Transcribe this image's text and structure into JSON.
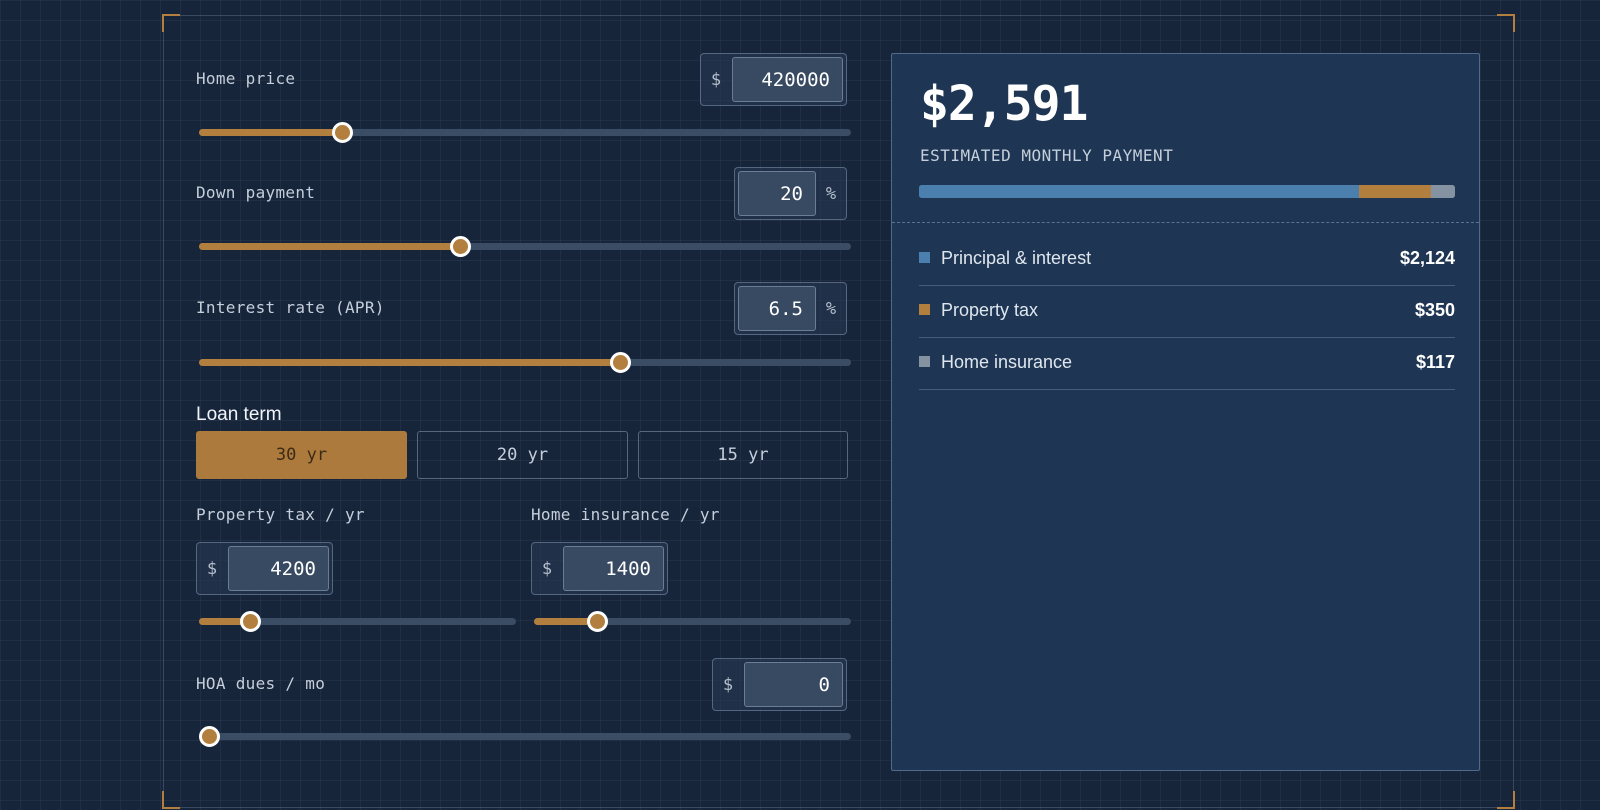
{
  "colors": {
    "accent": "#b27f3e",
    "principal": "#4a7fae",
    "tax": "#b27f3e",
    "insurance": "#8592a2",
    "panel": "#1e3653"
  },
  "home_price": {
    "label": "Home price",
    "prefix": "$",
    "value": "420000",
    "slider_level": 0.22
  },
  "down_payment": {
    "label": "Down payment",
    "value": "20",
    "suffix": "%",
    "slider_level": 0.4
  },
  "interest_rate": {
    "label": "Interest rate (APR)",
    "value": "6.5",
    "suffix": "%",
    "slider_level": 0.645
  },
  "loan_term": {
    "label": "Loan term",
    "options": [
      {
        "label": "30 yr",
        "active": true
      },
      {
        "label": "20 yr",
        "active": false
      },
      {
        "label": "15 yr",
        "active": false
      }
    ]
  },
  "property_tax": {
    "label": "Property tax / yr",
    "prefix": "$",
    "value": "4200",
    "slider_level": 0.16
  },
  "home_insurance": {
    "label": "Home insurance / yr",
    "prefix": "$",
    "value": "1400",
    "slider_level": 0.2
  },
  "hoa": {
    "label": "HOA dues / mo",
    "prefix": "$",
    "value": "0",
    "slider_level": 0.0
  },
  "summary": {
    "amount": "$2,591",
    "subtitle": "ESTIMATED MONTHLY PAYMENT",
    "breakdown": [
      {
        "label": "Principal & interest",
        "value": "$2,124",
        "share": 0.82,
        "color_key": "principal"
      },
      {
        "label": "Property tax",
        "value": "$350",
        "share": 0.135,
        "color_key": "tax"
      },
      {
        "label": "Home insurance",
        "value": "$117",
        "share": 0.045,
        "color_key": "insurance"
      }
    ]
  }
}
